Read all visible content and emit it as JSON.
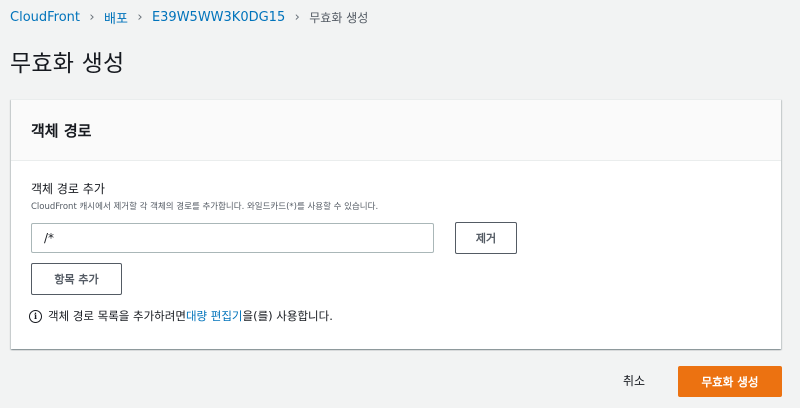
{
  "breadcrumb": {
    "items": [
      {
        "label": "CloudFront"
      },
      {
        "label": "배포"
      },
      {
        "label": "E39W5WW3K0DG15"
      },
      {
        "label": "무효화 생성"
      }
    ],
    "separator": "›"
  },
  "page": {
    "title": "무효화 생성"
  },
  "panel": {
    "title": "객체 경로",
    "field_label": "객체 경로 추가",
    "field_description": "CloudFront 캐시에서 제거할 각 객체의 경로를 추가합니다. 와일드카드(*)를 사용할 수 있습니다.",
    "path_value": "/*",
    "remove_button": "제거",
    "add_item_button": "항목 추가",
    "info": {
      "icon": "info-icon",
      "prefix": "객체 경로 목록을 추가하려면 ",
      "link": "대량 편집기",
      "suffix": "을(를) 사용합니다."
    }
  },
  "footer": {
    "cancel_label": "취소",
    "submit_label": "무효화 생성"
  },
  "colors": {
    "link": "#0073bb",
    "primary": "#ec7211",
    "background": "#f2f3f3"
  }
}
